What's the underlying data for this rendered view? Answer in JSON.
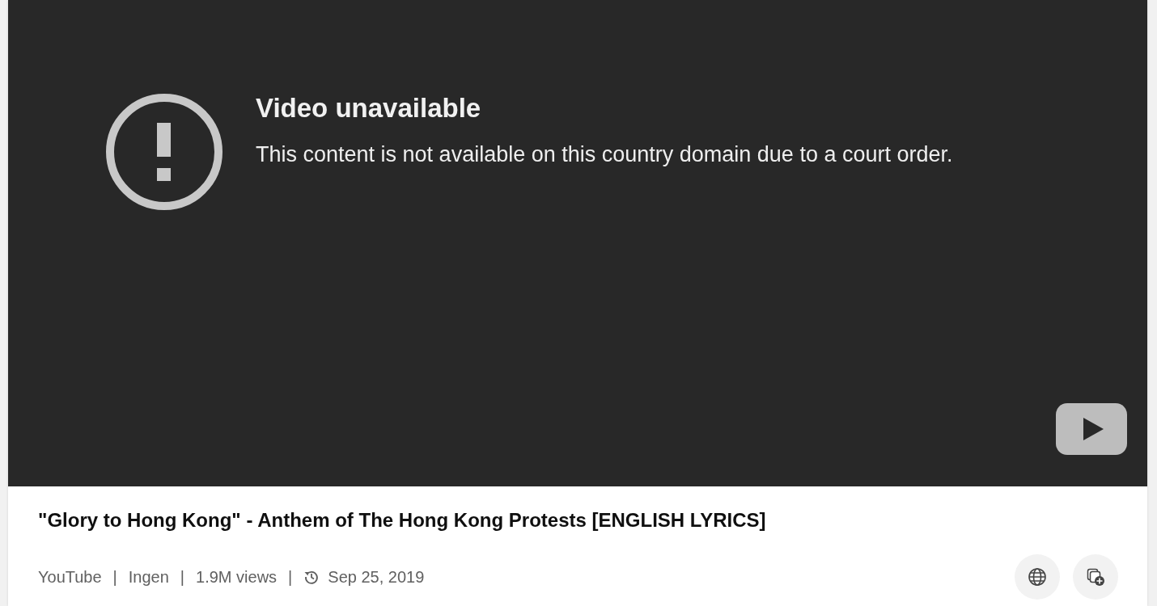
{
  "player": {
    "error_title": "Video unavailable",
    "error_message": "This content is not available on this country domain due to a court order."
  },
  "video": {
    "title": "\"Glory to Hong Kong\" - Anthem of The Hong Kong Protests [ENGLISH LYRICS]",
    "meta": [
      {
        "kind": "text",
        "text": "YouTube"
      },
      {
        "kind": "separator",
        "text": "|"
      },
      {
        "kind": "text",
        "text": "Ingen"
      },
      {
        "kind": "separator",
        "text": "|"
      },
      {
        "kind": "text",
        "text": "1.9M views"
      },
      {
        "kind": "separator",
        "text": "|"
      },
      {
        "kind": "date",
        "text": "Sep 25, 2019"
      }
    ],
    "actions": [
      {
        "kind": "globe"
      },
      {
        "kind": "collection-add"
      }
    ]
  }
}
